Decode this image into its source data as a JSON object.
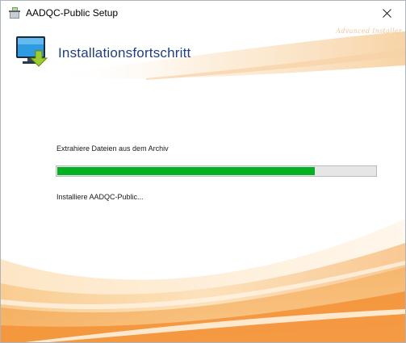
{
  "window": {
    "title": "AADQC-Public Setup",
    "close_symbol": "×"
  },
  "header": {
    "title": "Installationsfortschritt",
    "brand": "Advanced Installer",
    "icon": "monitor-download-icon"
  },
  "progress": {
    "status": "Extrahiere Dateien aus dem Archiv",
    "detail": "Installiere AADQC-Public...",
    "percent": 81,
    "color": "#06b025"
  },
  "colors": {
    "title": "#1f3e85",
    "accent_orange": "#f5a047"
  }
}
